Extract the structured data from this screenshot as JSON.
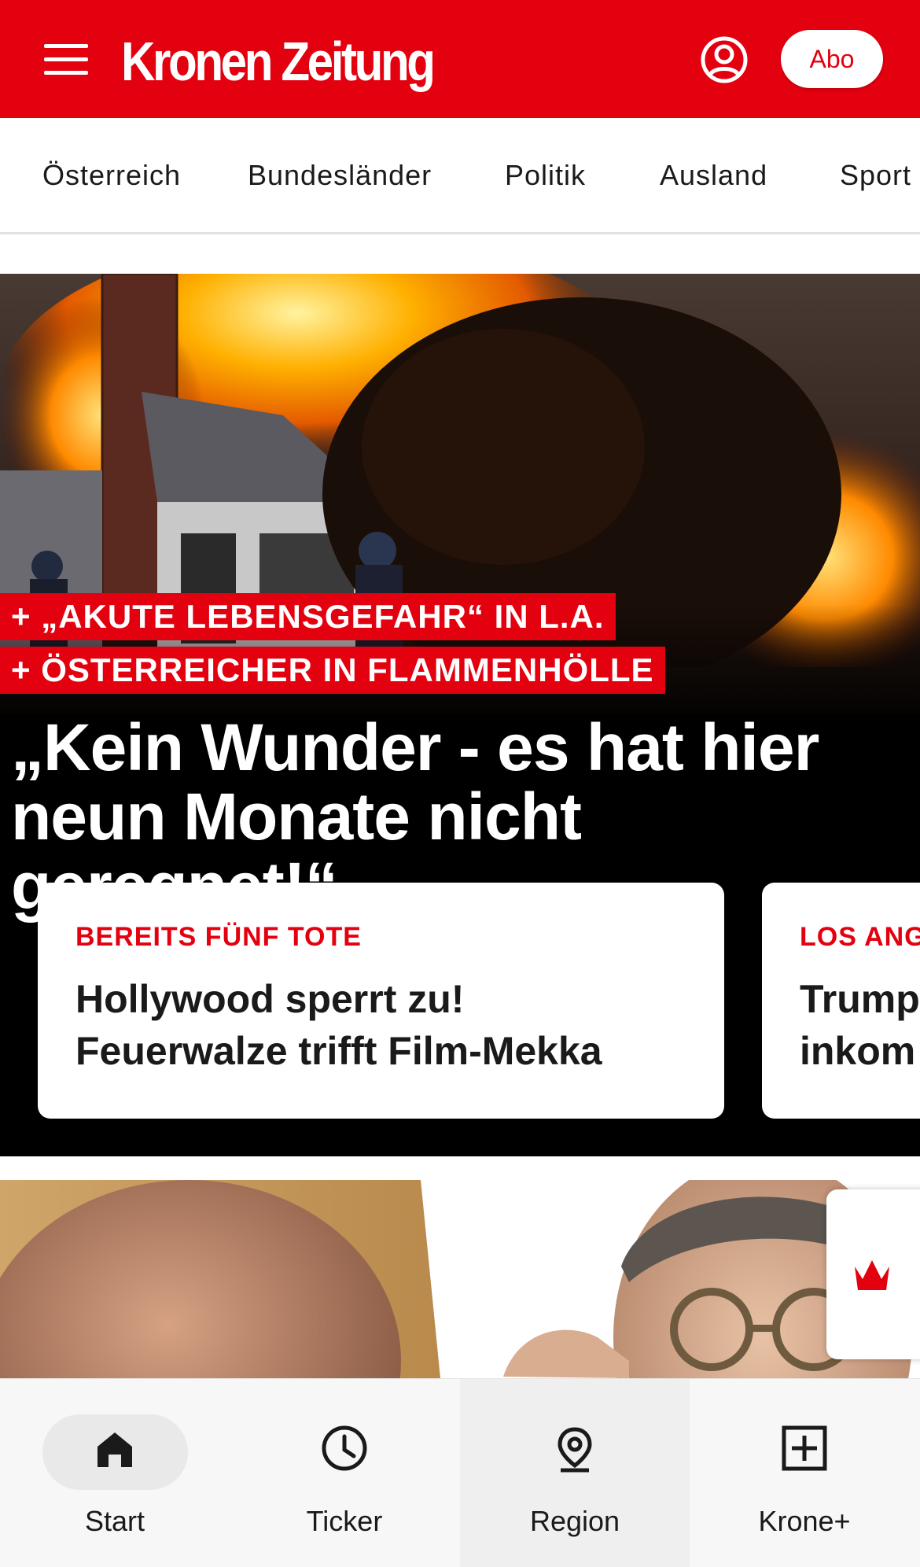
{
  "header": {
    "logo_text": "Kronen Zeitung",
    "abo_label": "Abo",
    "brand_color": "#e3000f",
    "icons": [
      "menu-icon",
      "account-icon"
    ]
  },
  "categories": [
    "Österreich",
    "Bundesländer",
    "Politik",
    "Ausland",
    "Sport"
  ],
  "hero": {
    "tags": [
      "+ „AKUTE LEBENSGEFAHR“ IN L.A.",
      "+ ÖSTERREICHER IN FLAMMENHÖLLE"
    ],
    "headline_line1": "„Kein Wunder - es hat hier",
    "headline_line2": "neun Monate nicht geregnet!“",
    "cards": [
      {
        "kicker": "BEREITS FÜNF TOTE",
        "title_line1": "Hollywood sperrt zu!",
        "title_line2": "Feuerwalze trifft Film-Mekka"
      },
      {
        "kicker": "LOS ANG",
        "title_line1": "Trump",
        "title_line2": "inkom"
      }
    ]
  },
  "crown_tab": {
    "icon": "crown-icon"
  },
  "bottom_nav": [
    {
      "label": "Start",
      "icon": "home-icon",
      "selected": true
    },
    {
      "label": "Ticker",
      "icon": "clock-icon"
    },
    {
      "label": "Region",
      "icon": "location-pin-icon"
    },
    {
      "label": "Krone+",
      "icon": "plus-box-icon"
    }
  ]
}
